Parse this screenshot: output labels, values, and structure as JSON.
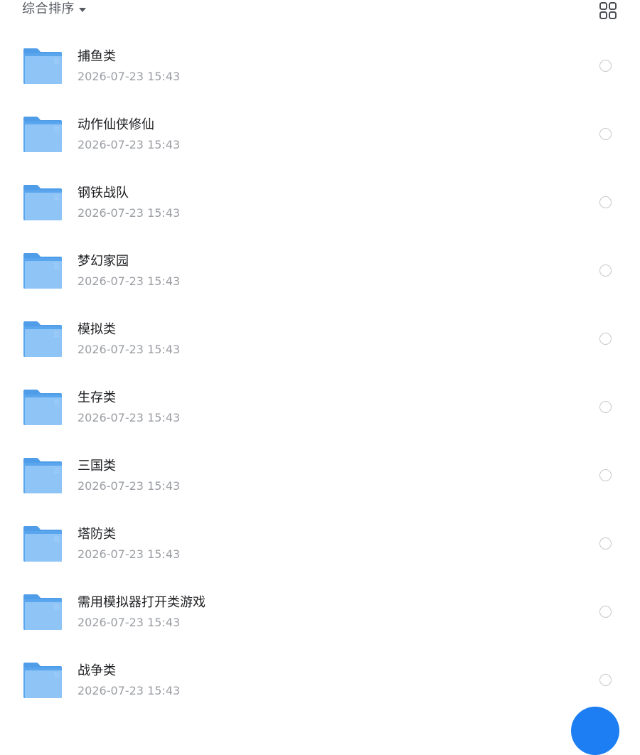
{
  "toolbar": {
    "sort_label": "综合排序",
    "sort_caret_icon": "caret-down-icon",
    "view_toggle_icon": "grid-view-icon"
  },
  "colors": {
    "folder_blue": "#5aa6ee",
    "folder_light": "#8ec4f6",
    "fab_blue": "#1c7ef2",
    "date_gray": "#9a9da3"
  },
  "folders": [
    {
      "name": "捕鱼类",
      "date": "2026-07-23 15:43"
    },
    {
      "name": "动作仙侠修仙",
      "date": "2026-07-23 15:43"
    },
    {
      "name": "钢铁战队",
      "date": "2026-07-23 15:43"
    },
    {
      "name": "梦幻家园",
      "date": "2026-07-23 15:43"
    },
    {
      "name": "模拟类",
      "date": "2026-07-23 15:43"
    },
    {
      "name": "生存类",
      "date": "2026-07-23 15:43"
    },
    {
      "name": "三国类",
      "date": "2026-07-23 15:43"
    },
    {
      "name": "塔防类",
      "date": "2026-07-23 15:43"
    },
    {
      "name": "需用模拟器打开类游戏",
      "date": "2026-07-23 15:43"
    },
    {
      "name": "战争类",
      "date": "2026-07-23 15:43"
    }
  ],
  "fab": {
    "icon": "floating-action-button"
  }
}
